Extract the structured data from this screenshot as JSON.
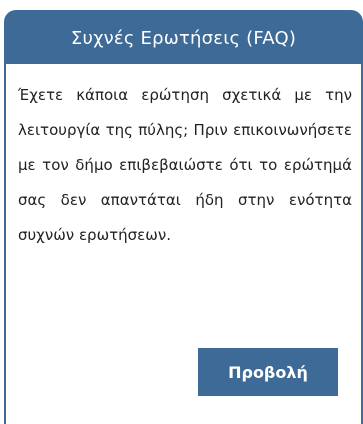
{
  "faq_widget": {
    "title": "Συχνές Ερωτήσεις (FAQ)",
    "description": "Έχετε κάποια ερώτηση σχετικά με την λειτουργία της πύλης; Πριν επικοινωνήσετε με τον δήμο επιβεβαιώστε ότι το ερώτημά σας δεν απαντάται ήδη στην ενότητα συχνών ερωτήσεων.",
    "view_button_label": "Προβολή",
    "colors": {
      "header_bg": "#3d6a96",
      "border": "#3d6a96",
      "button_bg": "#3d6a96",
      "header_text": "#ffffff",
      "body_text": "#222222"
    }
  }
}
